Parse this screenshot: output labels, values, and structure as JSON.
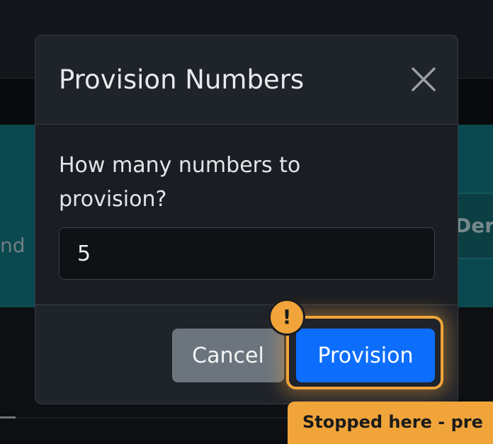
{
  "background": {
    "left_fragment": "nd",
    "right_button_fragment": "Der"
  },
  "dialog": {
    "title": "Provision Numbers",
    "close_icon": "close-x-icon",
    "question": "How many numbers to provision?",
    "quantity_value": "5",
    "cancel_label": "Cancel",
    "provision_label": "Provision"
  },
  "overlay": {
    "badge_glyph": "!",
    "banner_text": "Stopped here - pre",
    "accent_color": "#f0a43a"
  },
  "colors": {
    "primary": "#0d6efd",
    "secondary": "#6c757d",
    "band": "#0c5a61"
  }
}
